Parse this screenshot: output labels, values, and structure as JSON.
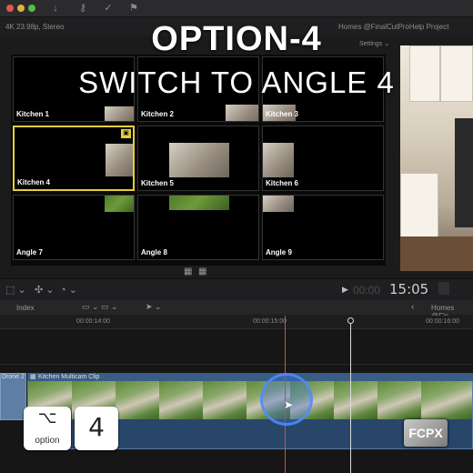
{
  "window": {
    "traffic_lights": [
      "#e4574e",
      "#e1b33a",
      "#4fbf47"
    ]
  },
  "toolbar_icons": [
    "download-icon",
    "key-icon",
    "check-icon",
    "flag-icon"
  ],
  "viewer": {
    "format": "4K 23.98p, Stereo",
    "project_title": "Homes @FinalCutProHelp Project",
    "settings_label": "Settings",
    "settings_chevron": "⌄"
  },
  "overlay": {
    "title": "OPTION-4",
    "subtitle": "SWITCH TO ANGLE 4"
  },
  "angles": [
    {
      "label": "Kitchen 1",
      "active": false
    },
    {
      "label": "Kitchen 2",
      "active": false
    },
    {
      "label": "Kitchen 3",
      "active": false
    },
    {
      "label": "Kitchen 4",
      "active": true
    },
    {
      "label": "Kitchen 5",
      "active": false
    },
    {
      "label": "Kitchen 6",
      "active": false
    },
    {
      "label": "Angle 7",
      "active": false
    },
    {
      "label": "Angle 8",
      "active": false
    },
    {
      "label": "Angle 9",
      "active": false
    }
  ],
  "timeline_toolbar": {
    "timecode": "15:05",
    "play_glyph": "▶",
    "timecode_prefix": "00:00"
  },
  "index_bar": {
    "index_label": "Index",
    "project_label": "Homes @Fin",
    "back_glyph": "‹"
  },
  "ruler": {
    "ticks": [
      "00:00:14:00",
      "00:00:15:00",
      "00:00:16:00"
    ]
  },
  "timeline": {
    "drone_label": "Drone 2",
    "clip_label": "Kitchen Multicam Clip"
  },
  "keys": {
    "option_symbol": "⌥",
    "option_label": "option",
    "number": "4"
  },
  "logo": {
    "text": "FCPX"
  },
  "colors": {
    "active_angle": "#e2cf3a",
    "clip_blue": "#27466a",
    "skimmer": "#d84a3f"
  }
}
